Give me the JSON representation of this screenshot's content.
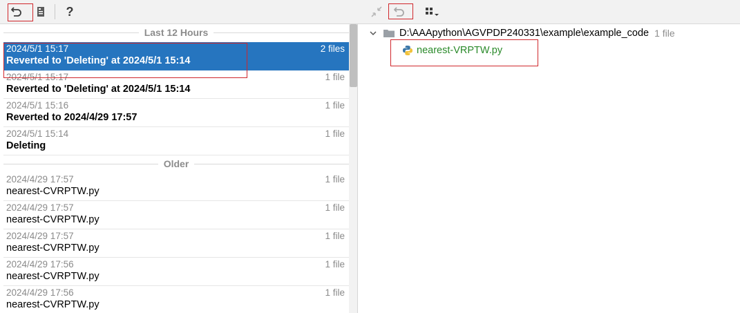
{
  "toolbar": {
    "left_buttons": [
      {
        "icon": "revert-icon",
        "label": "Revert"
      },
      {
        "icon": "book-icon",
        "label": "Show history"
      },
      {
        "icon": "help-icon",
        "label": "?"
      }
    ],
    "right_buttons": [
      {
        "icon": "collapse-icon"
      },
      {
        "icon": "revert-icon"
      },
      {
        "icon": "group-by-icon"
      }
    ]
  },
  "history": {
    "group_recent": "Last 12 Hours",
    "group_older": "Older",
    "recent": [
      {
        "date": "2024/5/1 15:17",
        "count": "2 files",
        "label": "Reverted to 'Deleting' at 2024/5/1 15:14",
        "selected": true
      },
      {
        "date": "2024/5/1 15:17",
        "count": "1 file",
        "label": "Reverted to 'Deleting' at 2024/5/1 15:14"
      },
      {
        "date": "2024/5/1 15:16",
        "count": "1 file",
        "label": "Reverted to 2024/4/29 17:57"
      },
      {
        "date": "2024/5/1 15:14",
        "count": "1 file",
        "label": "Deleting"
      }
    ],
    "older": [
      {
        "date": "2024/4/29 17:57",
        "count": "1 file",
        "label": "nearest-CVRPTW.py"
      },
      {
        "date": "2024/4/29 17:57",
        "count": "1 file",
        "label": "nearest-CVRPTW.py"
      },
      {
        "date": "2024/4/29 17:57",
        "count": "1 file",
        "label": "nearest-CVRPTW.py"
      },
      {
        "date": "2024/4/29 17:56",
        "count": "1 file",
        "label": "nearest-CVRPTW.py"
      },
      {
        "date": "2024/4/29 17:56",
        "count": "1 file",
        "label": "nearest-CVRPTW.py"
      }
    ]
  },
  "changes": {
    "root_path": "D:\\AAApython\\AGVPDP240331\\example\\example_code",
    "root_count": "1 file",
    "file_name": "nearest-VRPTW.py"
  },
  "colors": {
    "selection": "#2675bf",
    "highlight_box": "#d0262b",
    "file_added": "#2a8a2a"
  }
}
